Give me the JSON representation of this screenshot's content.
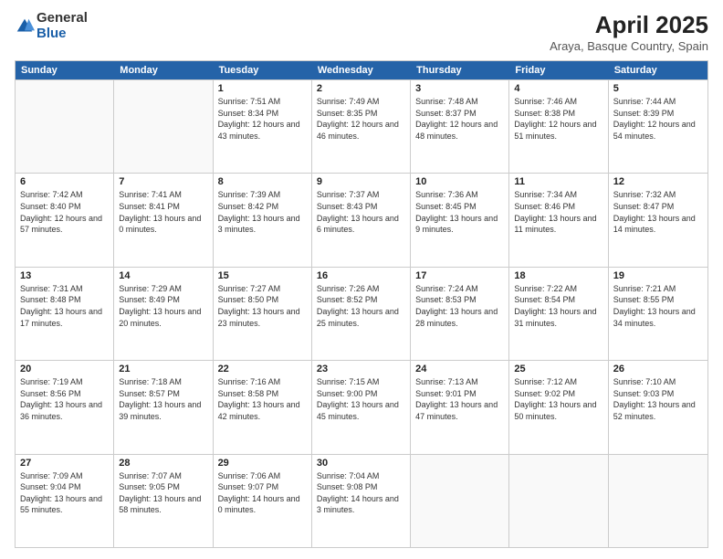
{
  "logo": {
    "general": "General",
    "blue": "Blue"
  },
  "title": {
    "month": "April 2025",
    "location": "Araya, Basque Country, Spain"
  },
  "weekdays": [
    "Sunday",
    "Monday",
    "Tuesday",
    "Wednesday",
    "Thursday",
    "Friday",
    "Saturday"
  ],
  "weeks": [
    [
      {
        "day": "",
        "info": ""
      },
      {
        "day": "",
        "info": ""
      },
      {
        "day": "1",
        "info": "Sunrise: 7:51 AM\nSunset: 8:34 PM\nDaylight: 12 hours and 43 minutes."
      },
      {
        "day": "2",
        "info": "Sunrise: 7:49 AM\nSunset: 8:35 PM\nDaylight: 12 hours and 46 minutes."
      },
      {
        "day": "3",
        "info": "Sunrise: 7:48 AM\nSunset: 8:37 PM\nDaylight: 12 hours and 48 minutes."
      },
      {
        "day": "4",
        "info": "Sunrise: 7:46 AM\nSunset: 8:38 PM\nDaylight: 12 hours and 51 minutes."
      },
      {
        "day": "5",
        "info": "Sunrise: 7:44 AM\nSunset: 8:39 PM\nDaylight: 12 hours and 54 minutes."
      }
    ],
    [
      {
        "day": "6",
        "info": "Sunrise: 7:42 AM\nSunset: 8:40 PM\nDaylight: 12 hours and 57 minutes."
      },
      {
        "day": "7",
        "info": "Sunrise: 7:41 AM\nSunset: 8:41 PM\nDaylight: 13 hours and 0 minutes."
      },
      {
        "day": "8",
        "info": "Sunrise: 7:39 AM\nSunset: 8:42 PM\nDaylight: 13 hours and 3 minutes."
      },
      {
        "day": "9",
        "info": "Sunrise: 7:37 AM\nSunset: 8:43 PM\nDaylight: 13 hours and 6 minutes."
      },
      {
        "day": "10",
        "info": "Sunrise: 7:36 AM\nSunset: 8:45 PM\nDaylight: 13 hours and 9 minutes."
      },
      {
        "day": "11",
        "info": "Sunrise: 7:34 AM\nSunset: 8:46 PM\nDaylight: 13 hours and 11 minutes."
      },
      {
        "day": "12",
        "info": "Sunrise: 7:32 AM\nSunset: 8:47 PM\nDaylight: 13 hours and 14 minutes."
      }
    ],
    [
      {
        "day": "13",
        "info": "Sunrise: 7:31 AM\nSunset: 8:48 PM\nDaylight: 13 hours and 17 minutes."
      },
      {
        "day": "14",
        "info": "Sunrise: 7:29 AM\nSunset: 8:49 PM\nDaylight: 13 hours and 20 minutes."
      },
      {
        "day": "15",
        "info": "Sunrise: 7:27 AM\nSunset: 8:50 PM\nDaylight: 13 hours and 23 minutes."
      },
      {
        "day": "16",
        "info": "Sunrise: 7:26 AM\nSunset: 8:52 PM\nDaylight: 13 hours and 25 minutes."
      },
      {
        "day": "17",
        "info": "Sunrise: 7:24 AM\nSunset: 8:53 PM\nDaylight: 13 hours and 28 minutes."
      },
      {
        "day": "18",
        "info": "Sunrise: 7:22 AM\nSunset: 8:54 PM\nDaylight: 13 hours and 31 minutes."
      },
      {
        "day": "19",
        "info": "Sunrise: 7:21 AM\nSunset: 8:55 PM\nDaylight: 13 hours and 34 minutes."
      }
    ],
    [
      {
        "day": "20",
        "info": "Sunrise: 7:19 AM\nSunset: 8:56 PM\nDaylight: 13 hours and 36 minutes."
      },
      {
        "day": "21",
        "info": "Sunrise: 7:18 AM\nSunset: 8:57 PM\nDaylight: 13 hours and 39 minutes."
      },
      {
        "day": "22",
        "info": "Sunrise: 7:16 AM\nSunset: 8:58 PM\nDaylight: 13 hours and 42 minutes."
      },
      {
        "day": "23",
        "info": "Sunrise: 7:15 AM\nSunset: 9:00 PM\nDaylight: 13 hours and 45 minutes."
      },
      {
        "day": "24",
        "info": "Sunrise: 7:13 AM\nSunset: 9:01 PM\nDaylight: 13 hours and 47 minutes."
      },
      {
        "day": "25",
        "info": "Sunrise: 7:12 AM\nSunset: 9:02 PM\nDaylight: 13 hours and 50 minutes."
      },
      {
        "day": "26",
        "info": "Sunrise: 7:10 AM\nSunset: 9:03 PM\nDaylight: 13 hours and 52 minutes."
      }
    ],
    [
      {
        "day": "27",
        "info": "Sunrise: 7:09 AM\nSunset: 9:04 PM\nDaylight: 13 hours and 55 minutes."
      },
      {
        "day": "28",
        "info": "Sunrise: 7:07 AM\nSunset: 9:05 PM\nDaylight: 13 hours and 58 minutes."
      },
      {
        "day": "29",
        "info": "Sunrise: 7:06 AM\nSunset: 9:07 PM\nDaylight: 14 hours and 0 minutes."
      },
      {
        "day": "30",
        "info": "Sunrise: 7:04 AM\nSunset: 9:08 PM\nDaylight: 14 hours and 3 minutes."
      },
      {
        "day": "",
        "info": ""
      },
      {
        "day": "",
        "info": ""
      },
      {
        "day": "",
        "info": ""
      }
    ]
  ]
}
